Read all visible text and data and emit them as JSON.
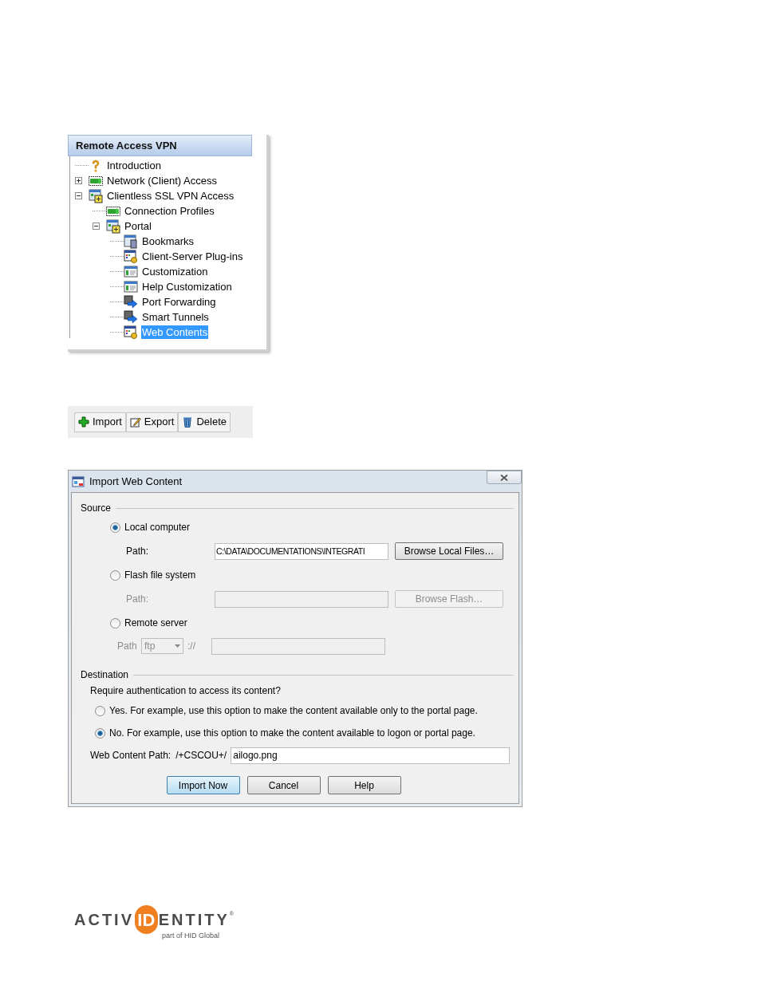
{
  "tree_panel": {
    "title": "Remote Access VPN",
    "items": [
      {
        "label": "Introduction",
        "kind": "help",
        "selected": false
      },
      {
        "label": "Network (Client) Access",
        "kind": "connector",
        "expanded": false,
        "selected": false
      },
      {
        "label": "Clientless SSL VPN Access",
        "kind": "portal",
        "expanded": true,
        "selected": false,
        "children": [
          {
            "label": "Connection Profiles",
            "kind": "connector",
            "selected": false
          },
          {
            "label": "Portal",
            "kind": "portal",
            "expanded": true,
            "selected": false,
            "children": [
              {
                "label": "Bookmarks",
                "kind": "bookmarks",
                "selected": false
              },
              {
                "label": "Client-Server Plug-ins",
                "kind": "plugin",
                "selected": false
              },
              {
                "label": "Customization",
                "kind": "window",
                "selected": false
              },
              {
                "label": "Help Customization",
                "kind": "window",
                "selected": false
              },
              {
                "label": "Port Forwarding",
                "kind": "forward",
                "selected": false
              },
              {
                "label": "Smart Tunnels",
                "kind": "forward",
                "selected": false
              },
              {
                "label": "Web Contents",
                "kind": "plugin",
                "selected": true
              }
            ]
          }
        ]
      }
    ]
  },
  "toolbar": {
    "buttons": [
      {
        "label": "Import",
        "kind": "add"
      },
      {
        "label": "Export",
        "kind": "edit"
      },
      {
        "label": "Delete",
        "kind": "delete"
      }
    ]
  },
  "dialog": {
    "title": "Import Web Content",
    "source": {
      "legend": "Source",
      "options": [
        {
          "kind": "local",
          "label": "Local computer",
          "selected": true,
          "path_label": "Path:",
          "path_value": "C:\\DATA\\DOCUMENTATIONS\\INTEGRATI",
          "browse": "Browse Local Files…"
        },
        {
          "kind": "flash",
          "label": "Flash file system",
          "selected": false,
          "path_label": "Path:",
          "browse": "Browse Flash…"
        },
        {
          "kind": "remote",
          "label": "Remote server",
          "selected": false,
          "path_label": "Path",
          "protocol": "ftp",
          "separator": "://"
        }
      ]
    },
    "destination": {
      "legend": "Destination",
      "question": "Require authentication to access its content?",
      "options": [
        {
          "label": "Yes. For example, use this option to make the content available only to the portal page.",
          "selected": false
        },
        {
          "label": "No. For example, use this option to make the content available to logon or portal page.",
          "selected": true
        }
      ],
      "path_label": "Web Content Path:",
      "path_prefix": "/+CSCOU+/",
      "path_value": "ailogo.png"
    },
    "buttons": [
      {
        "label": "Import Now",
        "default": true
      },
      {
        "label": "Cancel",
        "default": false
      },
      {
        "label": "Help",
        "default": false
      }
    ]
  },
  "logo": {
    "left": "ACTIV",
    "mark": "ID",
    "right": "ENTITY",
    "registered": "®",
    "tagline": "part of HID Global"
  }
}
